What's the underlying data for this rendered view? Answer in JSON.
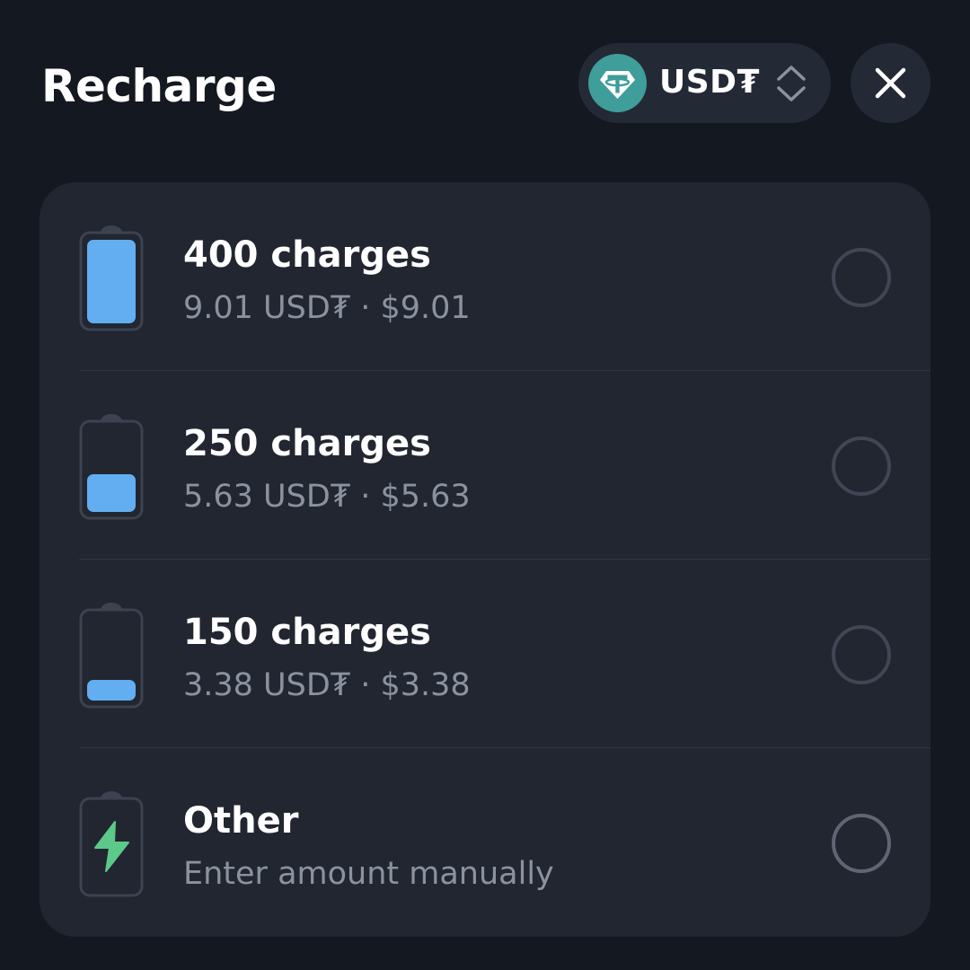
{
  "header": {
    "title": "Recharge",
    "currency": {
      "label": "USD₮",
      "logo_icon": "tether-icon",
      "logo_color": "#3f9d9a"
    }
  },
  "options": [
    {
      "title": "400 charges",
      "subtitle": "9.01 USD₮ · $9.01",
      "battery_level": 1.0,
      "selected": false
    },
    {
      "title": "250 charges",
      "subtitle": "5.63 USD₮ · $5.63",
      "battery_level": 0.45,
      "selected": false
    },
    {
      "title": "150 charges",
      "subtitle": "3.38 USD₮ · $3.38",
      "battery_level": 0.25,
      "selected": false
    },
    {
      "title": "Other",
      "subtitle": "Enter amount manually",
      "icon": "lightning-bolt-icon",
      "selected": false
    }
  ],
  "colors": {
    "background": "#141821",
    "card": "#212631",
    "battery_fill": "#62aef0",
    "bolt": "#5cc98a",
    "muted_text": "#8b929f"
  }
}
